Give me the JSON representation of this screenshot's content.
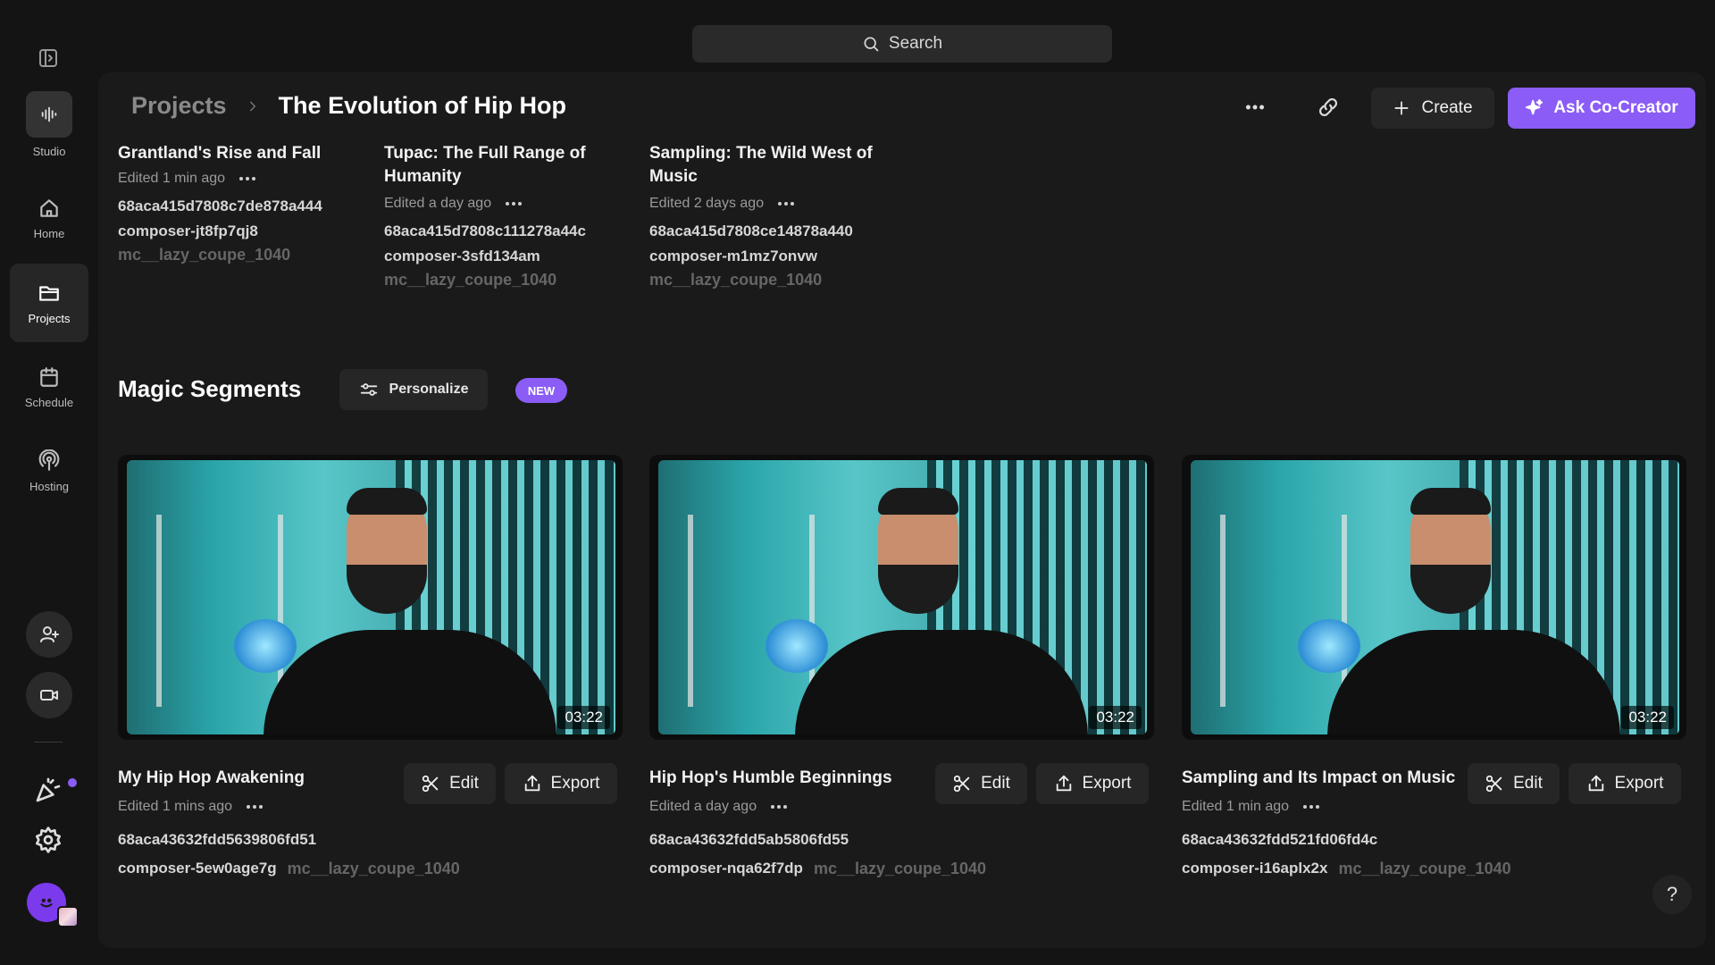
{
  "search": {
    "placeholder": "Search"
  },
  "sidebar": {
    "items": [
      {
        "label": "Studio",
        "icon": "waveform-icon"
      },
      {
        "label": "Home",
        "icon": "home-icon"
      },
      {
        "label": "Projects",
        "icon": "folder-icon",
        "active": true
      },
      {
        "label": "Schedule",
        "icon": "calendar-icon"
      },
      {
        "label": "Hosting",
        "icon": "podcast-icon"
      }
    ]
  },
  "header": {
    "breadcrumb_parent": "Projects",
    "title": "The Evolution of Hip Hop",
    "create_label": "Create",
    "ask_label": "Ask Co-Creator"
  },
  "projects": [
    {
      "title": "Grantland's Rise and Fall",
      "edited": "Edited 1 min ago",
      "id": "68aca415d7808c7de878a444",
      "composer": "composer-jt8fp7qj8",
      "tag": "mc__lazy_coupe_1040"
    },
    {
      "title": "Tupac: The Full Range of Humanity",
      "edited": "Edited a day ago",
      "id": "68aca415d7808c111278a44c",
      "composer": "composer-3sfd134am",
      "tag": "mc__lazy_coupe_1040"
    },
    {
      "title": "Sampling: The Wild West of Music",
      "edited": "Edited 2 days ago",
      "id": "68aca415d7808ce14878a440",
      "composer": "composer-m1mz7onvw",
      "tag": "mc__lazy_coupe_1040"
    }
  ],
  "magic": {
    "title": "Magic Segments",
    "personalize_label": "Personalize",
    "badge": "NEW",
    "edit_label": "Edit",
    "export_label": "Export",
    "segments": [
      {
        "title": "My Hip Hop Awakening",
        "edited": "Edited 1 mins ago",
        "id": "68aca43632fdd5639806fd51",
        "composer": "composer-5ew0age7g",
        "tag": "mc__lazy_coupe_1040",
        "duration": "03:22"
      },
      {
        "title": "Hip Hop's Humble Beginnings",
        "edited": "Edited a day ago",
        "id": "68aca43632fdd5ab5806fd55",
        "composer": "composer-nqa62f7dp",
        "tag": "mc__lazy_coupe_1040",
        "duration": "03:22"
      },
      {
        "title": "Sampling and Its Impact on Music",
        "edited": "Edited 1 min ago",
        "id": "68aca43632fdd521fd06fd4c",
        "composer": "composer-i16aplx2x",
        "tag": "mc__lazy_coupe_1040",
        "duration": "03:22"
      }
    ]
  },
  "help": {
    "label": "?"
  },
  "colors": {
    "accent": "#8b5cf6",
    "background": "#141414",
    "panel": "#1a1a1a"
  }
}
